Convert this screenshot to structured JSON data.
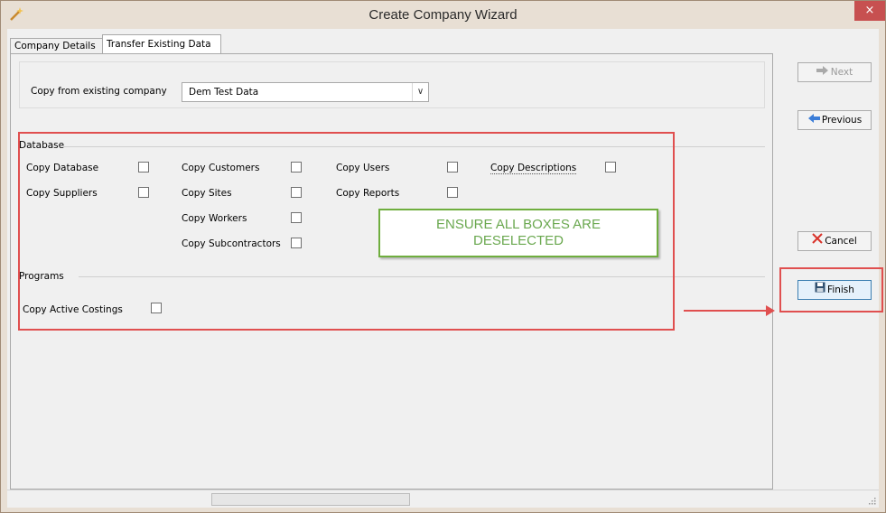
{
  "window": {
    "title": "Create Company Wizard",
    "close_glyph": "×"
  },
  "tabs": [
    {
      "label": "Company Details",
      "active": false
    },
    {
      "label": "Transfer Existing Data",
      "active": true
    }
  ],
  "company_selector": {
    "label": "Copy from existing company",
    "value": "Dem Test Data"
  },
  "database_group": {
    "title": "Database",
    "options": [
      {
        "label": "Copy Database",
        "checked": false
      },
      {
        "label": "Copy Customers",
        "checked": false
      },
      {
        "label": "Copy Users",
        "checked": false
      },
      {
        "label": "Copy Descriptions",
        "checked": false
      },
      {
        "label": "Copy Suppliers",
        "checked": false
      },
      {
        "label": "Copy Sites",
        "checked": false
      },
      {
        "label": "Copy Reports",
        "checked": false
      },
      {
        "label": "Copy Workers",
        "checked": false
      },
      {
        "label": "Copy Subcontractors",
        "checked": false
      }
    ]
  },
  "programs_group": {
    "title": "Programs",
    "options": [
      {
        "label": "Copy Active Costings",
        "checked": false
      }
    ]
  },
  "annotation": {
    "note_line1": "ENSURE ALL BOXES ARE",
    "note_line2": "DESELECTED",
    "highlight_color": "#e04f4f",
    "note_color": "#6aa84f"
  },
  "buttons": {
    "next": "Next",
    "previous": "Previous",
    "cancel": "Cancel",
    "finish": "Finish"
  },
  "icons": {
    "next": "arrow-right-icon",
    "previous": "arrow-left-icon",
    "cancel": "x-icon",
    "finish": "save-disk-icon",
    "app": "wizard-wand-icon"
  }
}
